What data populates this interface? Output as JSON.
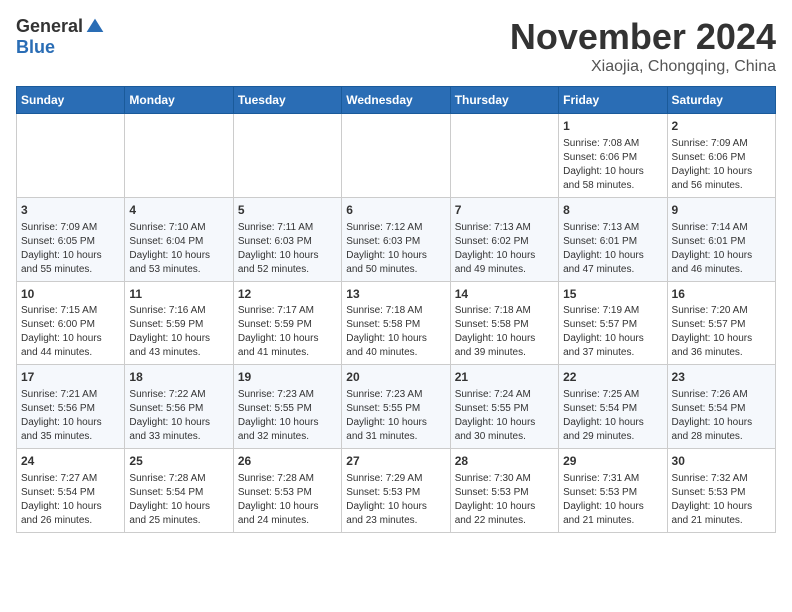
{
  "header": {
    "logo_general": "General",
    "logo_blue": "Blue",
    "month_title": "November 2024",
    "location": "Xiaojia, Chongqing, China"
  },
  "days_of_week": [
    "Sunday",
    "Monday",
    "Tuesday",
    "Wednesday",
    "Thursday",
    "Friday",
    "Saturday"
  ],
  "weeks": [
    [
      {
        "day": "",
        "info": ""
      },
      {
        "day": "",
        "info": ""
      },
      {
        "day": "",
        "info": ""
      },
      {
        "day": "",
        "info": ""
      },
      {
        "day": "",
        "info": ""
      },
      {
        "day": "1",
        "info": "Sunrise: 7:08 AM\nSunset: 6:06 PM\nDaylight: 10 hours and 58 minutes."
      },
      {
        "day": "2",
        "info": "Sunrise: 7:09 AM\nSunset: 6:06 PM\nDaylight: 10 hours and 56 minutes."
      }
    ],
    [
      {
        "day": "3",
        "info": "Sunrise: 7:09 AM\nSunset: 6:05 PM\nDaylight: 10 hours and 55 minutes."
      },
      {
        "day": "4",
        "info": "Sunrise: 7:10 AM\nSunset: 6:04 PM\nDaylight: 10 hours and 53 minutes."
      },
      {
        "day": "5",
        "info": "Sunrise: 7:11 AM\nSunset: 6:03 PM\nDaylight: 10 hours and 52 minutes."
      },
      {
        "day": "6",
        "info": "Sunrise: 7:12 AM\nSunset: 6:03 PM\nDaylight: 10 hours and 50 minutes."
      },
      {
        "day": "7",
        "info": "Sunrise: 7:13 AM\nSunset: 6:02 PM\nDaylight: 10 hours and 49 minutes."
      },
      {
        "day": "8",
        "info": "Sunrise: 7:13 AM\nSunset: 6:01 PM\nDaylight: 10 hours and 47 minutes."
      },
      {
        "day": "9",
        "info": "Sunrise: 7:14 AM\nSunset: 6:01 PM\nDaylight: 10 hours and 46 minutes."
      }
    ],
    [
      {
        "day": "10",
        "info": "Sunrise: 7:15 AM\nSunset: 6:00 PM\nDaylight: 10 hours and 44 minutes."
      },
      {
        "day": "11",
        "info": "Sunrise: 7:16 AM\nSunset: 5:59 PM\nDaylight: 10 hours and 43 minutes."
      },
      {
        "day": "12",
        "info": "Sunrise: 7:17 AM\nSunset: 5:59 PM\nDaylight: 10 hours and 41 minutes."
      },
      {
        "day": "13",
        "info": "Sunrise: 7:18 AM\nSunset: 5:58 PM\nDaylight: 10 hours and 40 minutes."
      },
      {
        "day": "14",
        "info": "Sunrise: 7:18 AM\nSunset: 5:58 PM\nDaylight: 10 hours and 39 minutes."
      },
      {
        "day": "15",
        "info": "Sunrise: 7:19 AM\nSunset: 5:57 PM\nDaylight: 10 hours and 37 minutes."
      },
      {
        "day": "16",
        "info": "Sunrise: 7:20 AM\nSunset: 5:57 PM\nDaylight: 10 hours and 36 minutes."
      }
    ],
    [
      {
        "day": "17",
        "info": "Sunrise: 7:21 AM\nSunset: 5:56 PM\nDaylight: 10 hours and 35 minutes."
      },
      {
        "day": "18",
        "info": "Sunrise: 7:22 AM\nSunset: 5:56 PM\nDaylight: 10 hours and 33 minutes."
      },
      {
        "day": "19",
        "info": "Sunrise: 7:23 AM\nSunset: 5:55 PM\nDaylight: 10 hours and 32 minutes."
      },
      {
        "day": "20",
        "info": "Sunrise: 7:23 AM\nSunset: 5:55 PM\nDaylight: 10 hours and 31 minutes."
      },
      {
        "day": "21",
        "info": "Sunrise: 7:24 AM\nSunset: 5:55 PM\nDaylight: 10 hours and 30 minutes."
      },
      {
        "day": "22",
        "info": "Sunrise: 7:25 AM\nSunset: 5:54 PM\nDaylight: 10 hours and 29 minutes."
      },
      {
        "day": "23",
        "info": "Sunrise: 7:26 AM\nSunset: 5:54 PM\nDaylight: 10 hours and 28 minutes."
      }
    ],
    [
      {
        "day": "24",
        "info": "Sunrise: 7:27 AM\nSunset: 5:54 PM\nDaylight: 10 hours and 26 minutes."
      },
      {
        "day": "25",
        "info": "Sunrise: 7:28 AM\nSunset: 5:54 PM\nDaylight: 10 hours and 25 minutes."
      },
      {
        "day": "26",
        "info": "Sunrise: 7:28 AM\nSunset: 5:53 PM\nDaylight: 10 hours and 24 minutes."
      },
      {
        "day": "27",
        "info": "Sunrise: 7:29 AM\nSunset: 5:53 PM\nDaylight: 10 hours and 23 minutes."
      },
      {
        "day": "28",
        "info": "Sunrise: 7:30 AM\nSunset: 5:53 PM\nDaylight: 10 hours and 22 minutes."
      },
      {
        "day": "29",
        "info": "Sunrise: 7:31 AM\nSunset: 5:53 PM\nDaylight: 10 hours and 21 minutes."
      },
      {
        "day": "30",
        "info": "Sunrise: 7:32 AM\nSunset: 5:53 PM\nDaylight: 10 hours and 21 minutes."
      }
    ]
  ]
}
